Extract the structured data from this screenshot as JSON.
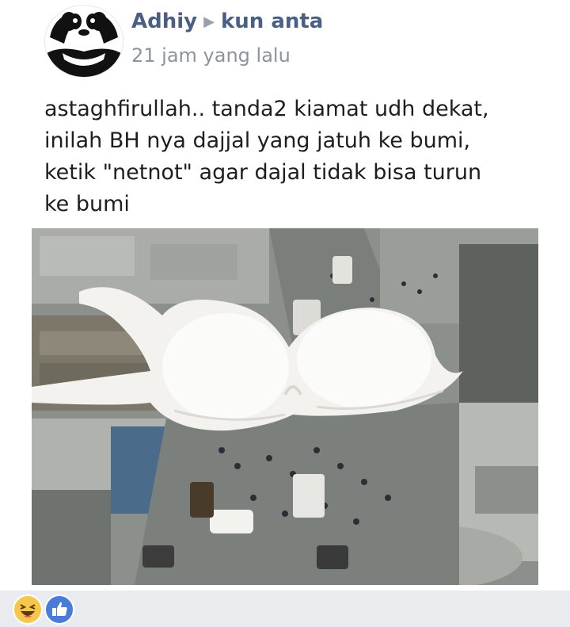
{
  "post": {
    "author": "Adhiy",
    "target": "kun anta",
    "time": "21 jam yang lalu",
    "text_lines": [
      "astaghfirullah.. tanda2 kiamat udh dekat,",
      "inilah BH nya dajjal yang jatuh ke bumi,",
      "ketik \"netnot\" agar dajal tidak bisa turun",
      "ke bumi"
    ],
    "reactions": [
      "haha-icon",
      "like-icon"
    ]
  },
  "colors": {
    "name": "#4b5f84",
    "timestamp": "#8d949e",
    "text": "#1c1e21",
    "like": "#4b7bd8",
    "haha": "#f7c74b"
  }
}
